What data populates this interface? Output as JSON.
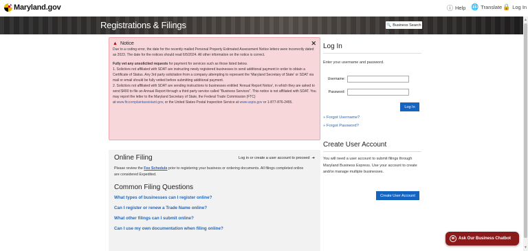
{
  "header": {
    "logo_text": "Maryland.gov",
    "help_label": "Help",
    "translate_label": "Translate",
    "login_label": "Log In"
  },
  "hero": {
    "title": "Registrations & Filings",
    "business_search_label": "Business Search"
  },
  "notice": {
    "title": "Notice",
    "p1": "Due to a coding error, the date for the recently mailed Personal Property Estimated Assessment Notice letters were incorrectly dated as 2023.  The date for the notices should read 6/5/2024.  All other information on the notice is correct.",
    "p2_bold": "Fully vet any unsolicited requests",
    "p2_rest": " for payment for services such as those listed below.",
    "p3": "1. Solicitors not affiliated with SDAT are instructing newly registered businesses to send additional payment in order to obtain a Certificate of Status. Any 3rd party solicitation from a company attempting to represent the 'Maryland Secretary of State' or SDAT via mail or email should be fully vetted before submitting additional payment.",
    "p4": "2. Solicitors not affiliated with SDAT are sending instructions to businesses entitled 'Annual Report Notice', in which they are asked to send $400 to file an Annual Report through a third party service called \"Business Services\". This notice is not affiliated with SDAT. You may report the letter to the Maryland Secretary of State, the Federal Trade Commission (FTC)",
    "p5_pre": "at ",
    "p5_link1": "www.ftccomplaintassistant.gov",
    "p5_mid": ", or the United States Postal Inspection Service at ",
    "p5_link2": "www.uspis.gov",
    "p5_end": " or 1-877-876-2455."
  },
  "online_filing": {
    "title": "Online Filing",
    "login_link": "Log in or create a user account to proceed",
    "text_pre": "Please review the ",
    "fee_schedule": "Fee Schedule",
    "text_post": " prior to registering your business or ordering documents. All filings completed online are considered Expedited."
  },
  "questions": {
    "title": "Common Filing Questions",
    "items": [
      "What types of businesses can I register online?",
      "Can I register or renew a Trade Name online?",
      "What other filings can I submit online?",
      "Can I use my own documentation when filing online?"
    ]
  },
  "login": {
    "title": "Log In",
    "instructions": "Enter your username and password.",
    "username_label": "Username:",
    "password_label": "Password:",
    "button": "Log In",
    "forgot_username": "» Forgot Username?",
    "forgot_password": "» Forgot Password?"
  },
  "create_account": {
    "title": "Create User Account",
    "text": "You will need a user account to submit filings through Maryland Business Express. Use your account to create and/or manage multiple businesses.",
    "button": "Create User Account"
  },
  "chatbot": {
    "label": "Ask Our Business Chatbot"
  },
  "colors": {
    "accent": "#1565c0",
    "notice_bg": "#f8d7da",
    "chatbot": "#8b1a1a",
    "link": "#2568b6"
  }
}
